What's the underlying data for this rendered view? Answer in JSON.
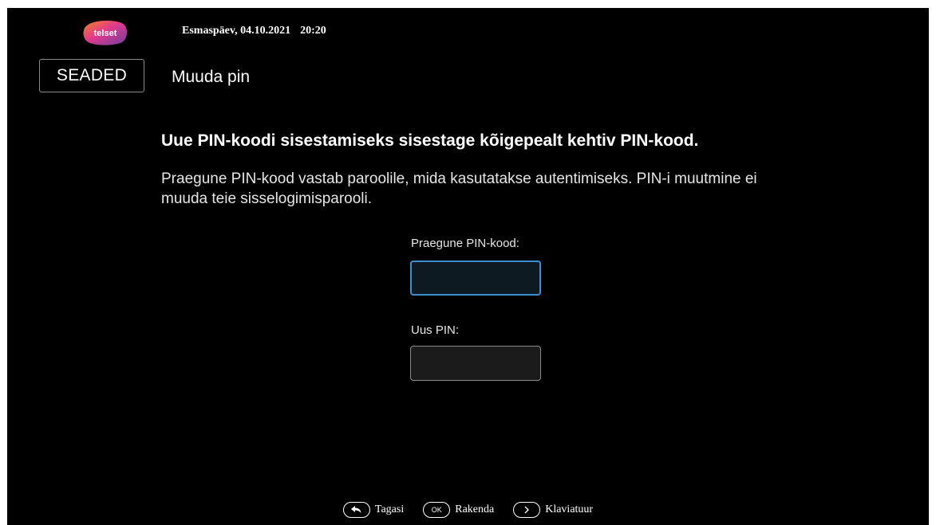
{
  "header": {
    "logo_text": "telset",
    "date": "Esmaspäev, 04.10.2021",
    "time": "20:20"
  },
  "section": {
    "label": "SEADED"
  },
  "page": {
    "title": "Muuda pin"
  },
  "content": {
    "heading": "Uue PIN-koodi sisestamiseks sisestage kõigepealt kehtiv PIN-kood.",
    "description": "Praegune PIN-kood vastab paroolile, mida kasutatakse autentimiseks. PIN-i muutmine ei muuda teie sisselogimisparooli."
  },
  "form": {
    "current_pin_label": "Praegune PIN-kood:",
    "current_pin_value": "",
    "new_pin_label": "Uus PIN:",
    "new_pin_value": ""
  },
  "footer": {
    "back_label": "Tagasi",
    "back_icon": "back-arrow-icon",
    "ok_icon_text": "OK",
    "ok_label": "Rakenda",
    "keyboard_icon": "chevron-right-icon",
    "keyboard_label": "Klaviatuur"
  },
  "colors": {
    "background": "#000000",
    "focus_border": "#3a8fd0",
    "logo_pink": "#e23a8c",
    "logo_orange": "#f58220",
    "logo_purple": "#6f3fa0"
  }
}
